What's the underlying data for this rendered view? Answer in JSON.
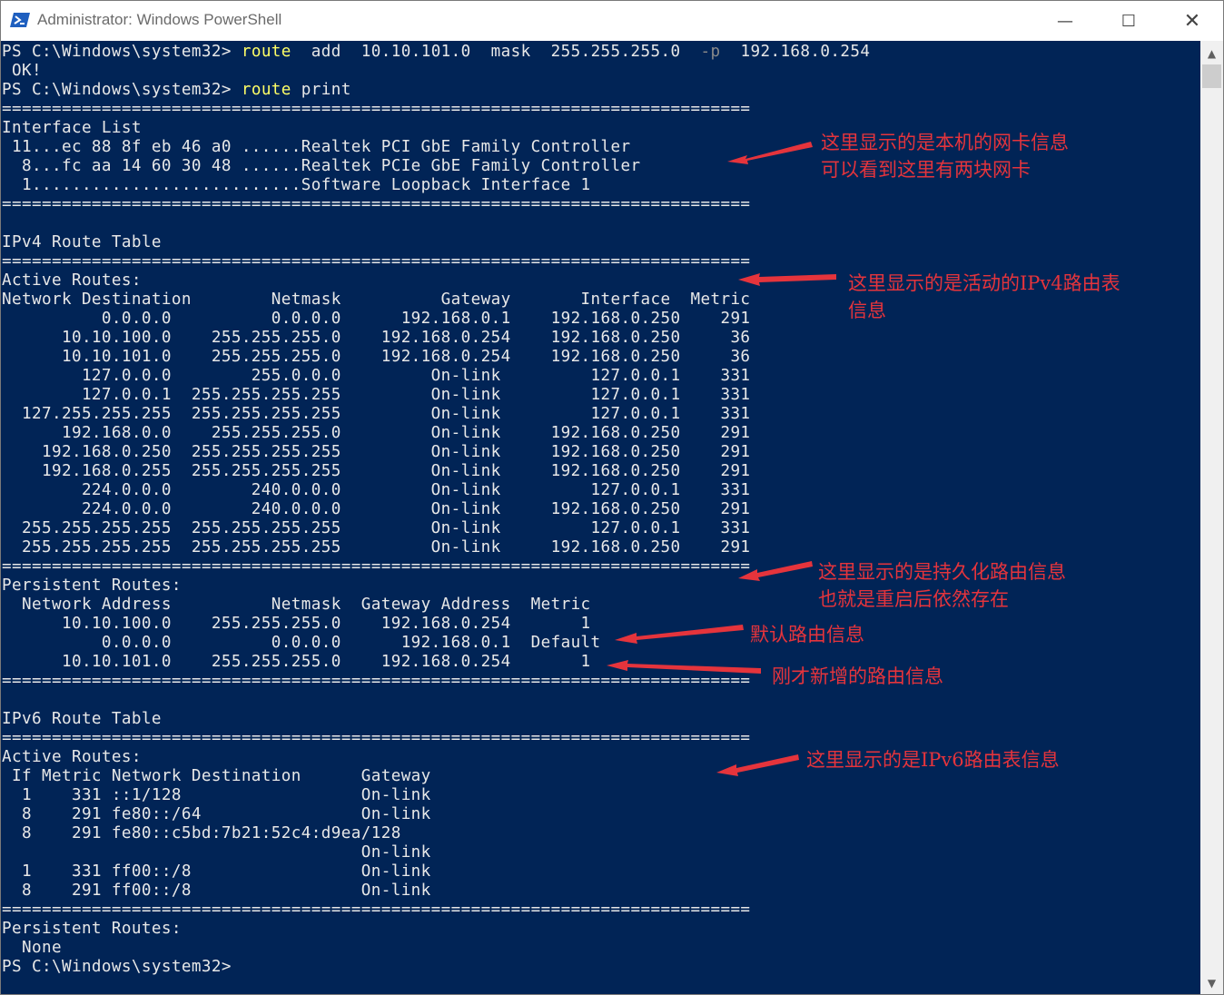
{
  "window": {
    "title": "Administrator: Windows PowerShell",
    "controls": {
      "minimize": "—",
      "maximize": "☐",
      "close": "✕"
    }
  },
  "terminal": {
    "command": {
      "prompt": "PS C:\\Windows\\system32> ",
      "cmd": "route",
      "args": "  add  10.10.101.0  mask  255.255.255.0  ",
      "flag": "-p",
      "gateway": "  192.168.0.254"
    },
    "ok_line": " OK!",
    "print_command": {
      "prompt": "PS C:\\Windows\\system32> ",
      "cmd": "route",
      "args": " print"
    },
    "output": "===========================================================================\nInterface List\n 11...ec 88 8f eb 46 a0 ......Realtek PCI GbE Family Controller\n  8...fc aa 14 60 30 48 ......Realtek PCIe GbE Family Controller\n  1...........................Software Loopback Interface 1\n===========================================================================\n\nIPv4 Route Table\n===========================================================================\nActive Routes:\nNetwork Destination        Netmask          Gateway       Interface  Metric\n          0.0.0.0          0.0.0.0      192.168.0.1    192.168.0.250    291\n      10.10.100.0    255.255.255.0    192.168.0.254    192.168.0.250     36\n      10.10.101.0    255.255.255.0    192.168.0.254    192.168.0.250     36\n        127.0.0.0        255.0.0.0         On-link         127.0.0.1    331\n        127.0.0.1  255.255.255.255         On-link         127.0.0.1    331\n  127.255.255.255  255.255.255.255         On-link         127.0.0.1    331\n      192.168.0.0    255.255.255.0         On-link     192.168.0.250    291\n    192.168.0.250  255.255.255.255         On-link     192.168.0.250    291\n    192.168.0.255  255.255.255.255         On-link     192.168.0.250    291\n        224.0.0.0        240.0.0.0         On-link         127.0.0.1    331\n        224.0.0.0        240.0.0.0         On-link     192.168.0.250    291\n  255.255.255.255  255.255.255.255         On-link         127.0.0.1    331\n  255.255.255.255  255.255.255.255         On-link     192.168.0.250    291\n===========================================================================\nPersistent Routes:\n  Network Address          Netmask  Gateway Address  Metric\n      10.10.100.0    255.255.255.0    192.168.0.254       1\n          0.0.0.0          0.0.0.0      192.168.0.1  Default\n      10.10.101.0    255.255.255.0    192.168.0.254       1\n===========================================================================\n\nIPv6 Route Table\n===========================================================================\nActive Routes:\n If Metric Network Destination      Gateway\n  1    331 ::1/128                  On-link\n  8    291 fe80::/64                On-link\n  8    291 fe80::c5bd:7b21:52c4:d9ea/128\n                                    On-link\n  1    331 ff00::/8                 On-link\n  8    291 ff00::/8                 On-link\n===========================================================================\nPersistent Routes:\n  None",
    "final_prompt": "PS C:\\Windows\\system32>"
  },
  "annotations": [
    {
      "lines": [
        "这里显示的是本机的网卡信息",
        "可以看到这里有两块网卡"
      ]
    },
    {
      "lines": [
        "这里显示的是活动的IPv4路由表",
        "信息"
      ]
    },
    {
      "lines": [
        "这里显示的是持久化路由信息",
        "也就是重启后依然存在"
      ]
    },
    {
      "lines": [
        "默认路由信息"
      ]
    },
    {
      "lines": [
        "刚才新增的路由信息"
      ]
    },
    {
      "lines": [
        "这里显示的是IPv6路由表信息"
      ]
    }
  ],
  "colors": {
    "console_bg": "#012456",
    "console_text": "#e8e8e8",
    "command": "#ffff66",
    "parameter": "#8a8a8a",
    "annotation": "#e5343c"
  }
}
